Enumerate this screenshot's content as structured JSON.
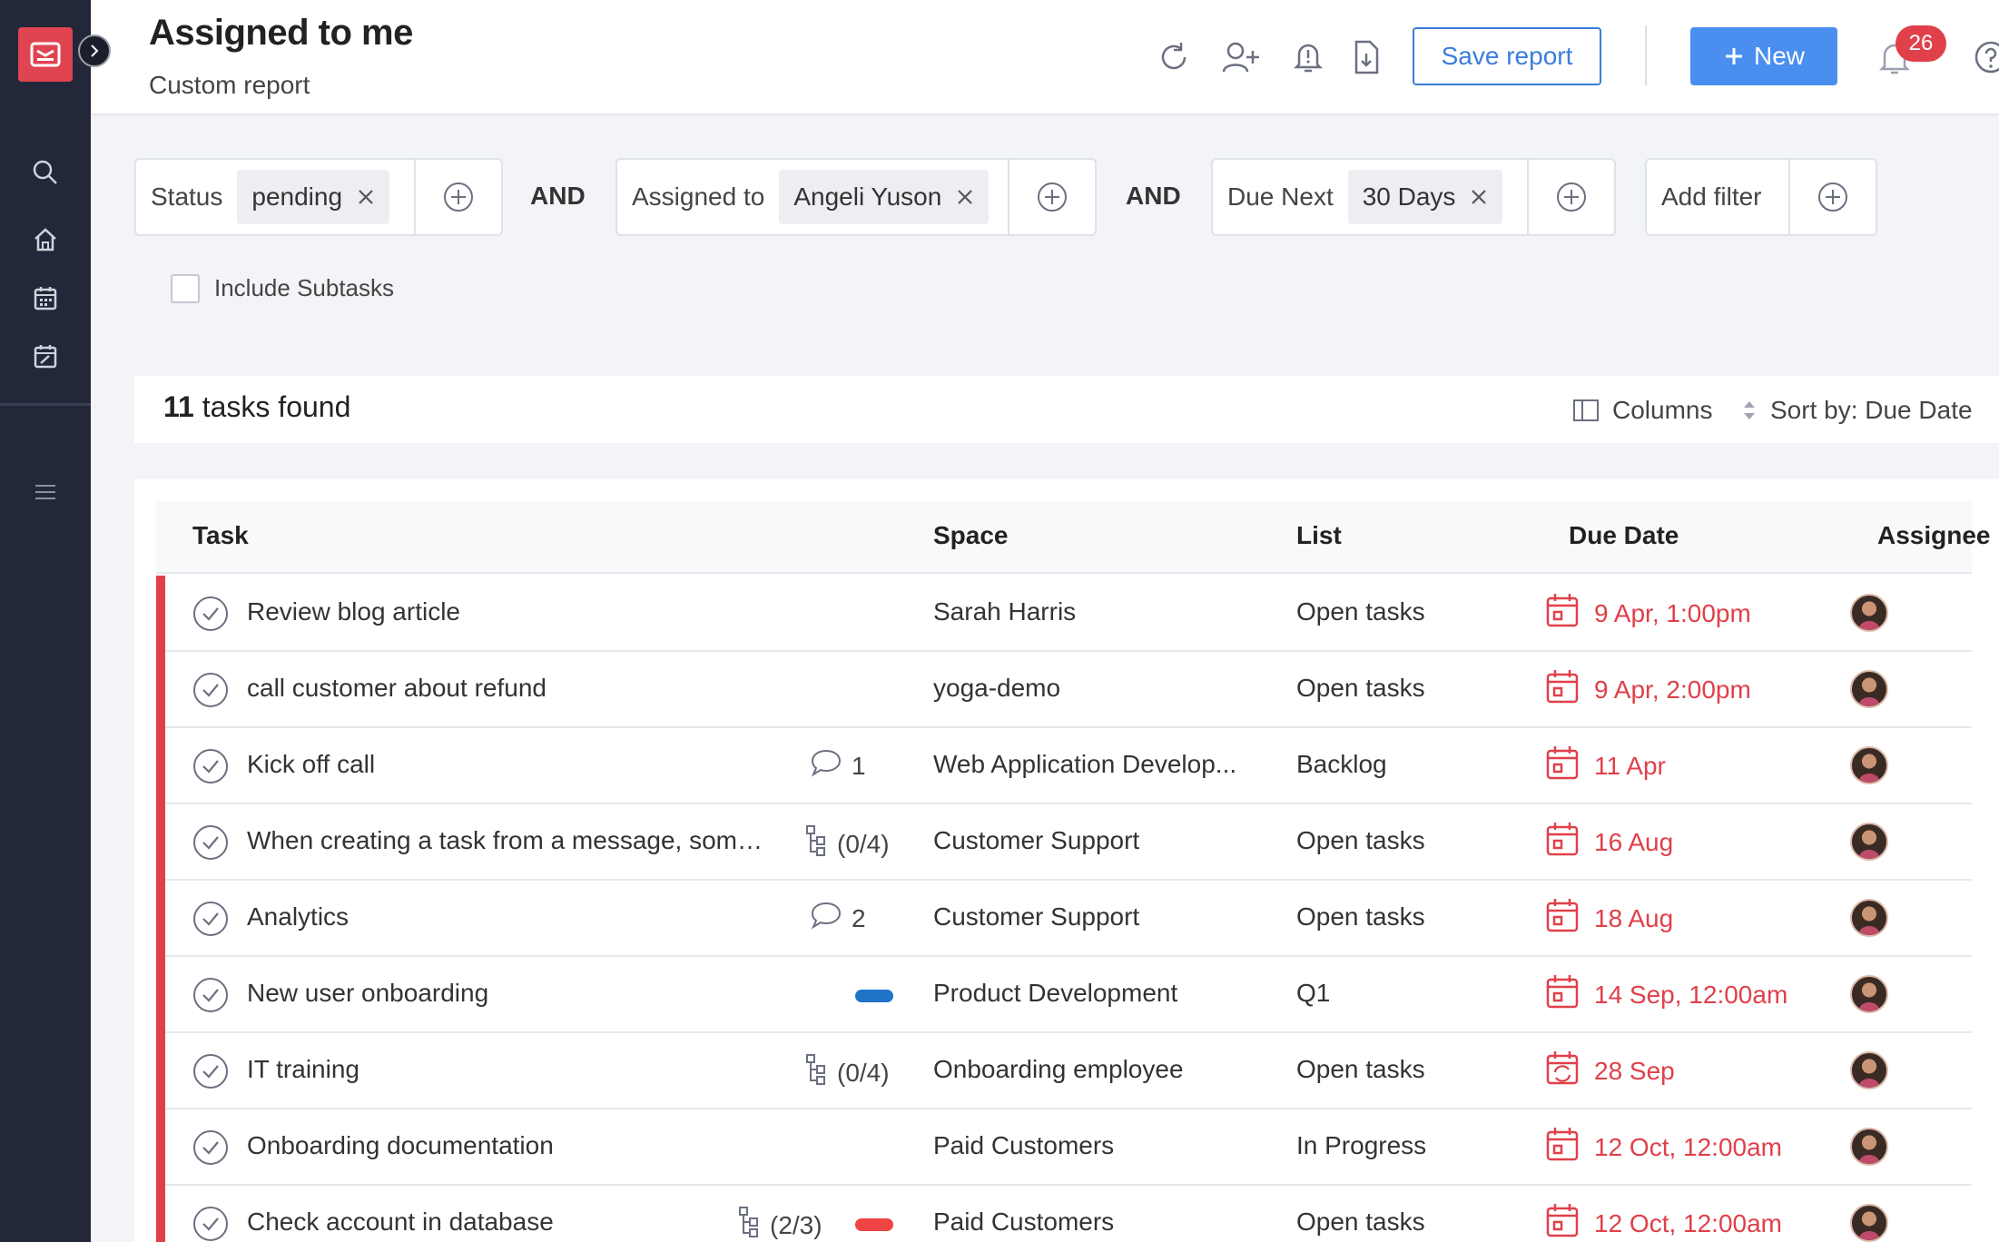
{
  "header": {
    "title": "Assigned to me",
    "subtitle": "Custom report",
    "save_label": "Save report",
    "new_label": "New",
    "notification_count": "26"
  },
  "filters": [
    {
      "label": "Status",
      "value": "pending"
    },
    {
      "label": "Assigned to",
      "value": "Angeli Yuson"
    },
    {
      "label": "Due Next",
      "value": "30 Days"
    }
  ],
  "and_label": "AND",
  "add_filter_label": "Add filter",
  "include_subtasks_label": "Include Subtasks",
  "results": {
    "count": "11",
    "label": "tasks found",
    "columns_label": "Columns",
    "sort_label": "Sort by: Due Date"
  },
  "table": {
    "headers": {
      "task": "Task",
      "space": "Space",
      "list": "List",
      "due": "Due Date",
      "assignee": "Assignee"
    },
    "rows": [
      {
        "task": "Review blog article",
        "space": "Sarah Harris",
        "list": "Open tasks",
        "due": "9 Apr, 1:00pm"
      },
      {
        "task": "call customer about refund",
        "space": "yoga-demo",
        "list": "Open tasks",
        "due": "9 Apr, 2:00pm"
      },
      {
        "task": "Kick off call",
        "comments": "1",
        "space": "Web Application Develop...",
        "list": "Backlog",
        "due": "11 Apr"
      },
      {
        "task": "When creating a task from a message, someti...",
        "subtasks": "(0/4)",
        "space": "Customer Support",
        "list": "Open tasks",
        "due": "16 Aug"
      },
      {
        "task": "Analytics",
        "comments": "2",
        "space": "Customer Support",
        "list": "Open tasks",
        "due": "18 Aug"
      },
      {
        "task": "New user onboarding",
        "tag_color": "#1f74c8",
        "space": "Product Development",
        "list": "Q1",
        "due": "14 Sep, 12:00am"
      },
      {
        "task": "IT training",
        "subtasks": "(0/4)",
        "space": "Onboarding employee",
        "list": "Open tasks",
        "due": "28 Sep",
        "recurring": true
      },
      {
        "task": "Onboarding documentation",
        "space": "Paid Customers",
        "list": "In Progress",
        "due": "12 Oct, 12:00am"
      },
      {
        "task": "Check account in database",
        "subtasks": "(2/3)",
        "tag_color": "#ef4444",
        "space": "Paid Customers",
        "list": "Open tasks",
        "due": "12 Oct, 12:00am"
      }
    ]
  },
  "colors": {
    "accent": "#4a8ff0",
    "overdue": "#e0404a",
    "sidebar": "#22283a"
  }
}
